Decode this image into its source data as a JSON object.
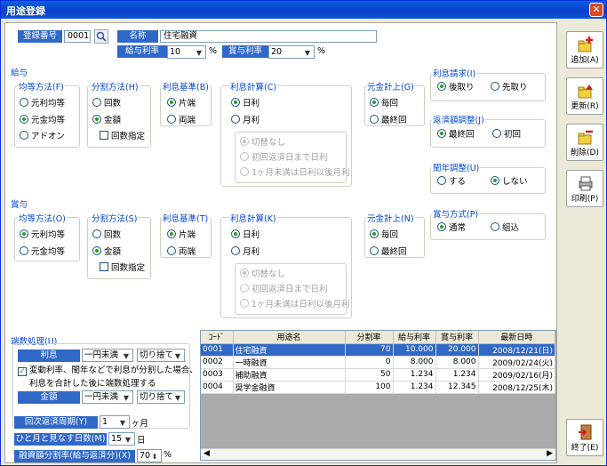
{
  "window": {
    "title": "用途登録",
    "close": "✕"
  },
  "header": {
    "code_label": "登録番号",
    "code_value": "0001",
    "name_label": "名称",
    "name_value": "住宅融資",
    "rate_label": "給与利率",
    "rate_value": "10",
    "rate_unit": "%",
    "bonus_rate_label": "賞与利率",
    "bonus_rate_value": "20",
    "bonus_rate_unit": "%"
  },
  "salary": {
    "section": "給与",
    "equal": {
      "title": "均等方法(F)",
      "options": [
        "元利均等",
        "元金均等",
        "アドオン"
      ],
      "selected": 1
    },
    "split": {
      "title": "分割方法(H)",
      "options": [
        "回数",
        "金額"
      ],
      "selected": 1,
      "check": "回数指定"
    },
    "interest_base": {
      "title": "利息基準(B)",
      "options": [
        "片端",
        "両端"
      ],
      "selected": 0
    },
    "interest_calc": {
      "title": "利息計算(C)",
      "options": [
        "日利",
        "月利"
      ],
      "selected": 0,
      "sub": [
        "切替なし",
        "初回返済日まで日利",
        "1ヶ月未満は日利以後月利"
      ]
    },
    "principal": {
      "title": "元金計上(G)",
      "options": [
        "毎回",
        "最終回"
      ],
      "selected": 0
    }
  },
  "bonus": {
    "section": "賞与",
    "equal": {
      "title": "均等方法(O)",
      "options": [
        "元利均等",
        "元金均等"
      ],
      "selected": 0
    },
    "split": {
      "title": "分割方法(S)",
      "options": [
        "回数",
        "金額"
      ],
      "selected": 1,
      "check": "回数指定"
    },
    "interest_base": {
      "title": "利息基準(T)",
      "options": [
        "片端",
        "両端"
      ],
      "selected": 0
    },
    "interest_calc": {
      "title": "利息計算(K)",
      "options": [
        "日利",
        "月利"
      ],
      "selected": 0,
      "sub": [
        "切替なし",
        "初回返済日まで日利",
        "1ヶ月未満は日利以後月利"
      ]
    },
    "principal": {
      "title": "元金計上(N)",
      "options": [
        "毎回",
        "最終回"
      ],
      "selected": 0
    }
  },
  "right": {
    "interest_claim": {
      "title": "利息請求(I)",
      "options": [
        "後取り",
        "先取り"
      ],
      "selected": 0
    },
    "repay_adjust": {
      "title": "返済額調整(J)",
      "options": [
        "最終回",
        "初回"
      ],
      "selected": 0
    },
    "leap_adjust": {
      "title": "閏年調整(U)",
      "options": [
        "する",
        "しない"
      ],
      "selected": 1
    },
    "bonus_method": {
      "title": "賞与方式(P)",
      "options": [
        "通常",
        "組込"
      ],
      "selected": 0
    }
  },
  "rounding": {
    "title": "端数処理(U)",
    "interest_label": "利息",
    "interest_unit": "一円未満",
    "interest_mode": "切り捨て",
    "check_text_1": "変動利率、閏年などで利息が分割した場合、",
    "check_text_2": "利息を合計した後に端数処理する",
    "amount_label": "金額",
    "amount_unit": "一円未満",
    "amount_mode": "切り捨て"
  },
  "cycle": {
    "label": "回次返済周期(Y)",
    "value": "1",
    "unit": "ヶ月"
  },
  "month_days": {
    "label": "ひと月と見なす日数(M)",
    "value": "15",
    "unit": "日"
  },
  "ratio": {
    "label": "融資額分割率(給与返済分)(X)",
    "value": "70",
    "unit": "%"
  },
  "table": {
    "columns": [
      "ｺｰﾄﾞ",
      "用途名",
      "分割率",
      "給与利率",
      "賞与利率",
      "最新日時"
    ],
    "rows": [
      [
        "0001",
        "住宅融資",
        "70",
        "10.000",
        "20.000",
        "2008/12/21(日)"
      ],
      [
        "0002",
        "一時融資",
        "0",
        "8.000",
        "8.000",
        "2009/02/24(火)"
      ],
      [
        "0003",
        "補助融資",
        "50",
        "1.234",
        "1.234",
        "2009/02/16(月)"
      ],
      [
        "0004",
        "奨学金融資",
        "100",
        "1.234",
        "12.345",
        "2008/12/25(木)"
      ]
    ]
  },
  "buttons": {
    "add": "追加(A)",
    "update": "更新(R)",
    "delete": "削除(D)",
    "print": "印刷(P)",
    "exit": "終了(E)"
  },
  "colors": {
    "accent": "#3068c8",
    "title_bar": "#0a5fe0",
    "selected_row": "#3169c6"
  }
}
